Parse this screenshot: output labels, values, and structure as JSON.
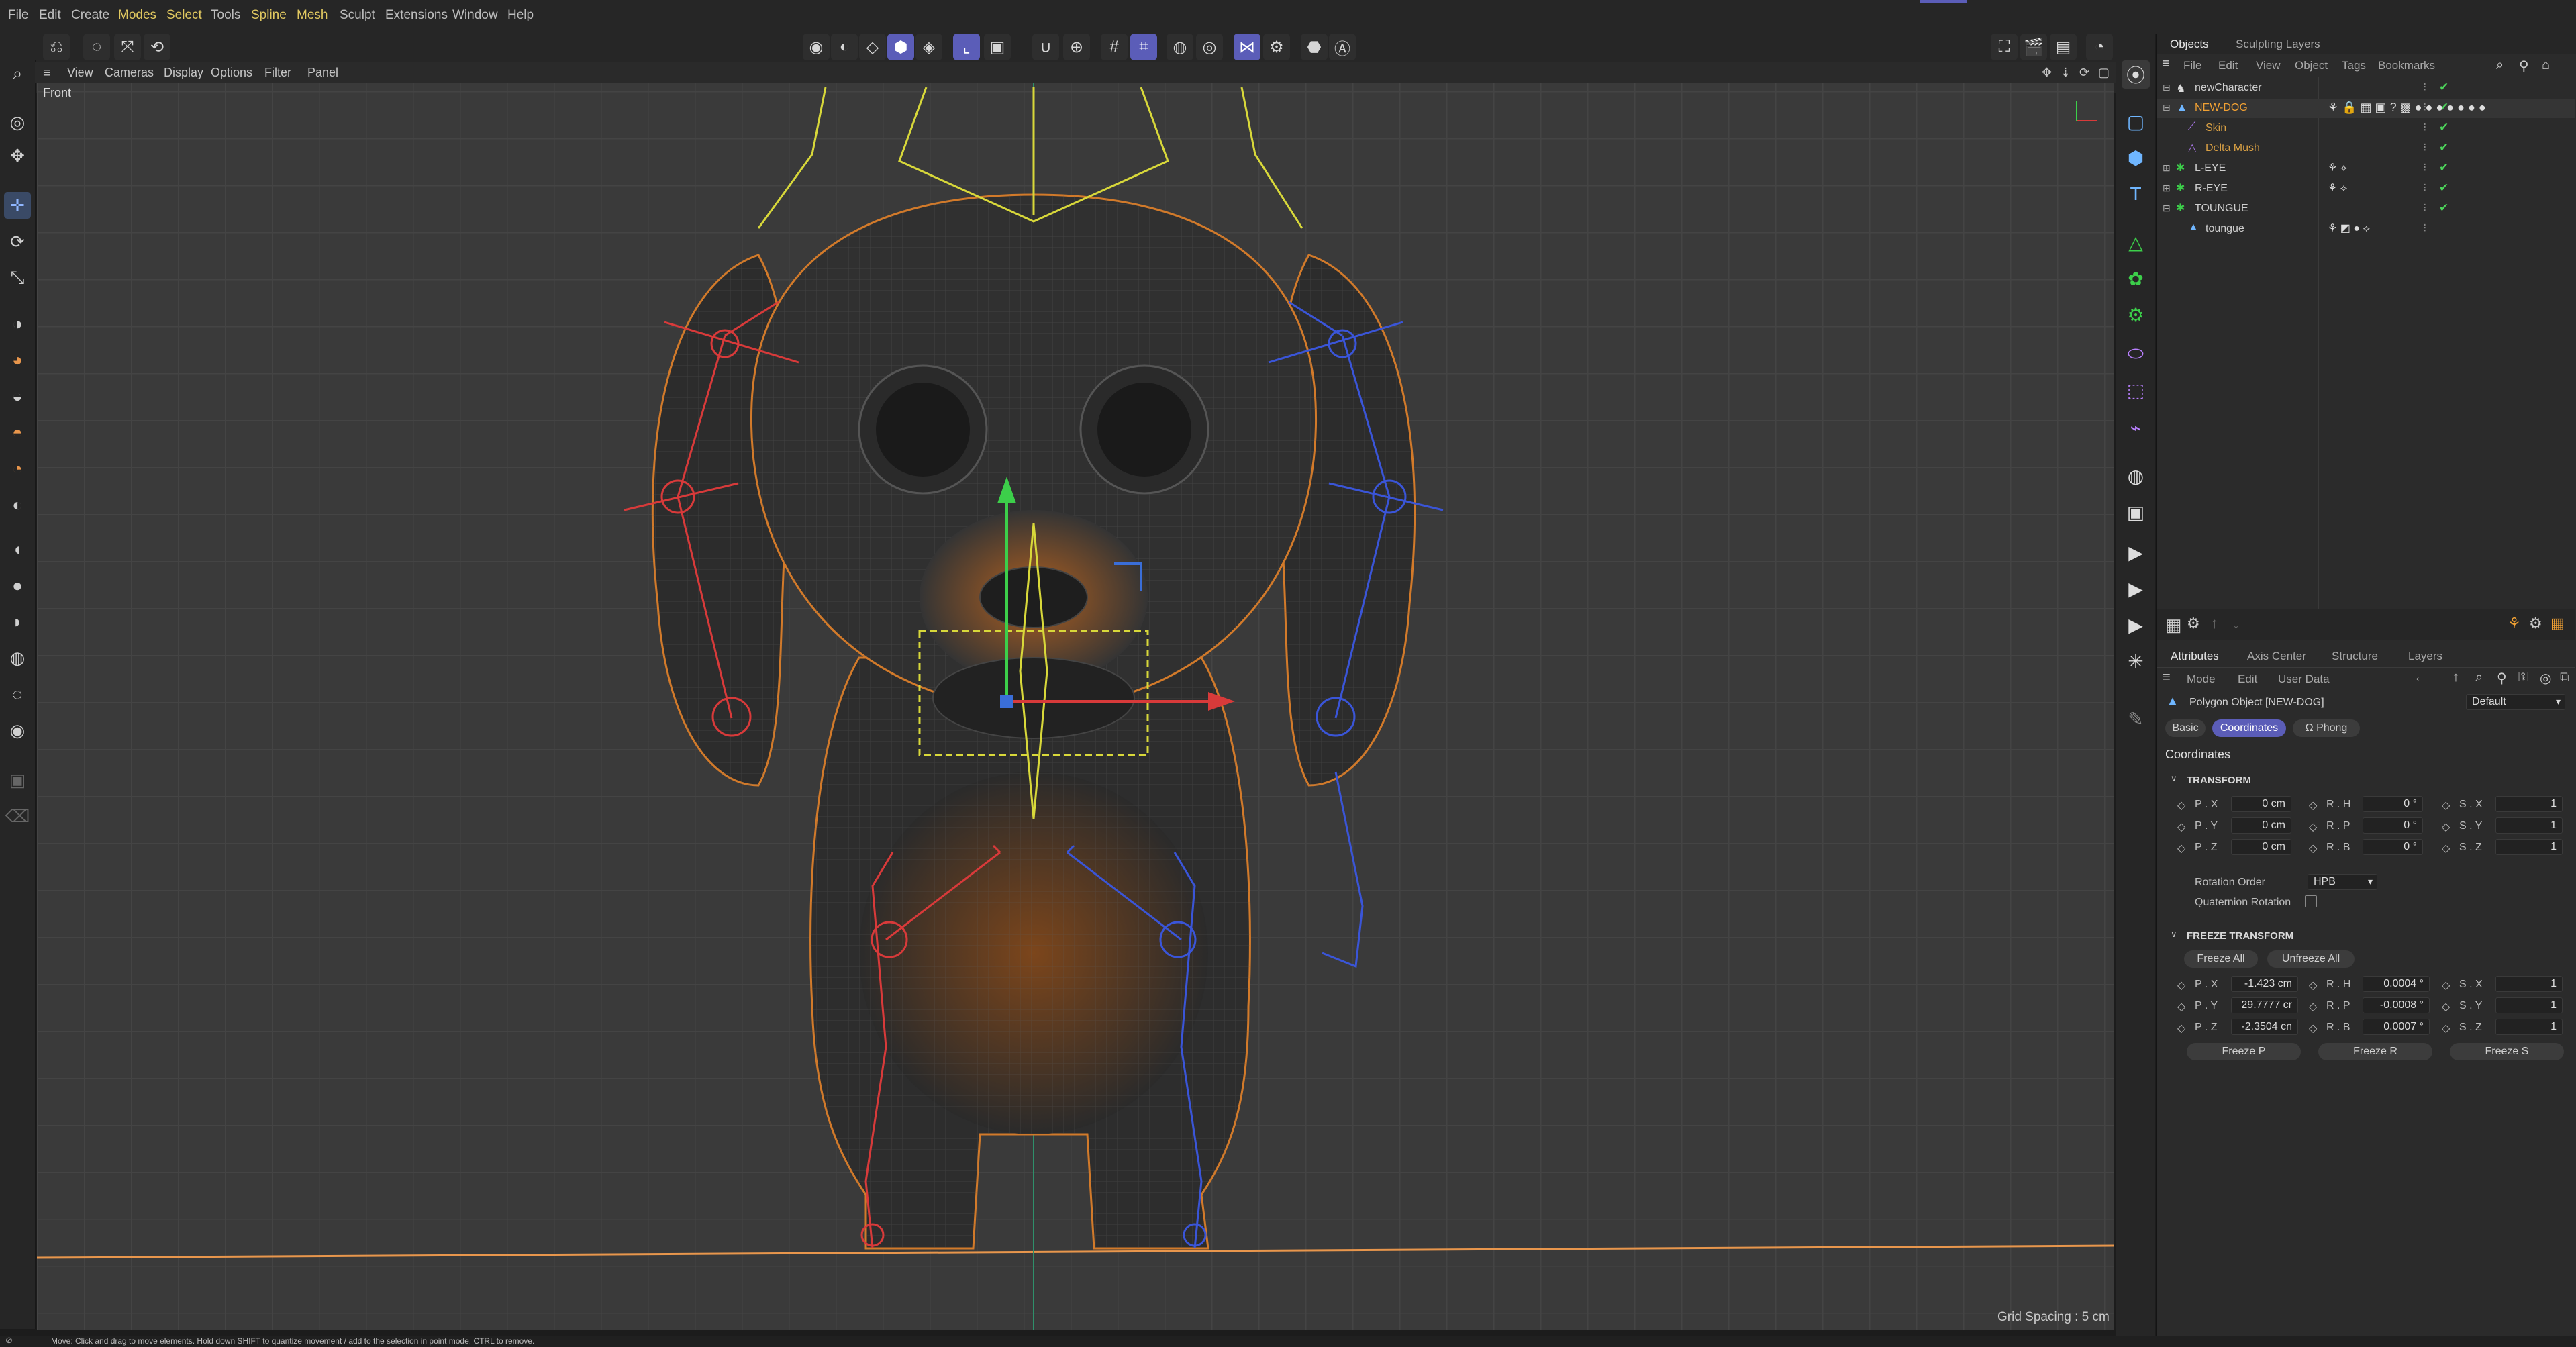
{
  "menu": [
    "File",
    "Edit",
    "Create",
    "Modes",
    "Select",
    "Tools",
    "Spline",
    "Mesh",
    "Sculpt",
    "Extensions",
    "Window",
    "Help"
  ],
  "viewport": {
    "menu": [
      "View",
      "Cameras",
      "Display",
      "Options",
      "Filter",
      "Panel"
    ],
    "label": "Front",
    "grid_spacing": "Grid Spacing : 5 cm"
  },
  "objects_panel": {
    "tabs": [
      "Objects",
      "Sculpting Layers"
    ],
    "menu": [
      "File",
      "Edit",
      "View",
      "Object",
      "Tags",
      "Bookmarks"
    ],
    "items": [
      {
        "name": "newCharacter",
        "color": "#cfcfcf"
      },
      {
        "name": "NEW-DOG",
        "color": "#f0a033"
      },
      {
        "name": "Skin",
        "color": "#d9a044"
      },
      {
        "name": "Delta Mush",
        "color": "#d9a044"
      },
      {
        "name": "L-EYE",
        "color": "#cfcfcf"
      },
      {
        "name": "R-EYE",
        "color": "#cfcfcf"
      },
      {
        "name": "TOUNGUE",
        "color": "#cfcfcf"
      },
      {
        "name": "toungue",
        "color": "#cfcfcf"
      }
    ]
  },
  "attributes": {
    "tabs": [
      "Attributes",
      "Axis Center",
      "Structure",
      "Layers"
    ],
    "menu": [
      "Mode",
      "Edit",
      "User Data"
    ],
    "object_title": "Polygon Object [NEW-DOG]",
    "preset": "Default",
    "subtabs": [
      "Basic",
      "Coordinates",
      "Phong"
    ],
    "section_title": "Coordinates",
    "transform_header": "TRANSFORM",
    "transform": {
      "p": [
        {
          "l": "P . X",
          "v": "0 cm"
        },
        {
          "l": "P . Y",
          "v": "0 cm"
        },
        {
          "l": "P . Z",
          "v": "0 cm"
        }
      ],
      "r": [
        {
          "l": "R . H",
          "v": "0 °"
        },
        {
          "l": "R . P",
          "v": "0 °"
        },
        {
          "l": "R . B",
          "v": "0 °"
        }
      ],
      "s": [
        {
          "l": "S . X",
          "v": "1"
        },
        {
          "l": "S . Y",
          "v": "1"
        },
        {
          "l": "S . Z",
          "v": "1"
        }
      ]
    },
    "rotation_order_label": "Rotation Order",
    "rotation_order": "HPB",
    "quaternion_label": "Quaternion Rotation",
    "freeze_header": "FREEZE TRANSFORM",
    "freeze_all": "Freeze All",
    "unfreeze_all": "Unfreeze All",
    "freeze": {
      "p": [
        {
          "l": "P . X",
          "v": "-1.423 cm"
        },
        {
          "l": "P . Y",
          "v": "29.7777 cr"
        },
        {
          "l": "P . Z",
          "v": "-2.3504 cn"
        }
      ],
      "r": [
        {
          "l": "R . H",
          "v": "0.0004 °"
        },
        {
          "l": "R . P",
          "v": "-0.0008 °"
        },
        {
          "l": "R . B",
          "v": "0.0007 °"
        }
      ],
      "s": [
        {
          "l": "S . X",
          "v": "1"
        },
        {
          "l": "S . Y",
          "v": "1"
        },
        {
          "l": "S . Z",
          "v": "1"
        }
      ]
    },
    "freeze_p": "Freeze P",
    "freeze_r": "Freeze R",
    "freeze_s": "Freeze S"
  },
  "status": "Move: Click and drag to move elements. Hold down SHIFT to quantize movement / add to the selection in point mode, CTRL to remove.",
  "colors": {
    "accent": "#5b5db8",
    "highlight_menu": "#e0c860",
    "object_orange": "#f0a033",
    "check": "#4cd35a"
  }
}
